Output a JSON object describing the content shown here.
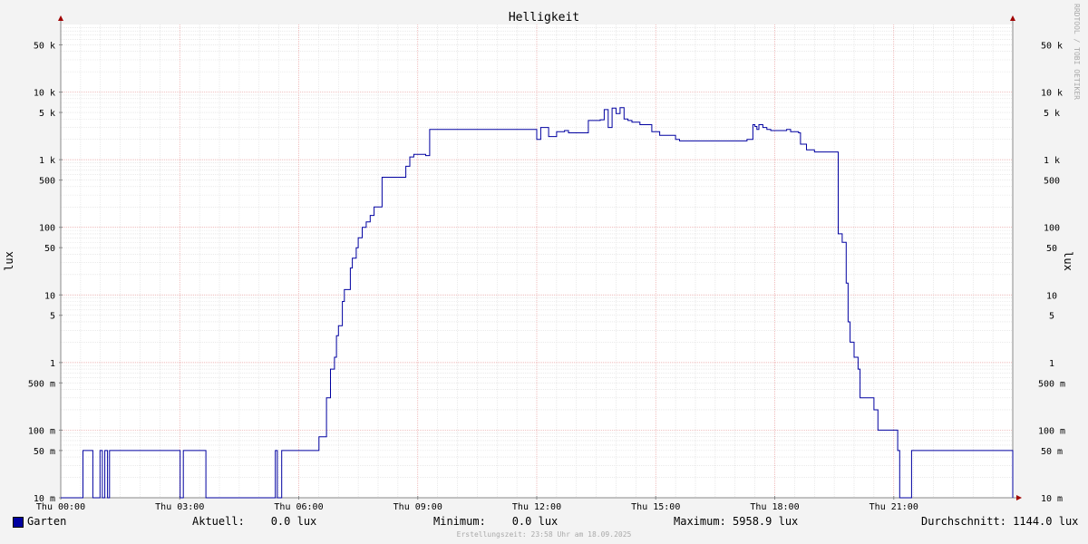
{
  "chart_data": {
    "type": "line",
    "title": "Helligkeit",
    "ylabel": "lux",
    "yscale": "log",
    "ylim": [
      0.01,
      100000
    ],
    "xlim": [
      0,
      24
    ],
    "grid": true,
    "x_ticks": [
      {
        "x": 0,
        "label": "Thu 00:00"
      },
      {
        "x": 3,
        "label": "Thu 03:00"
      },
      {
        "x": 6,
        "label": "Thu 06:00"
      },
      {
        "x": 9,
        "label": "Thu 09:00"
      },
      {
        "x": 12,
        "label": "Thu 12:00"
      },
      {
        "x": 15,
        "label": "Thu 15:00"
      },
      {
        "x": 18,
        "label": "Thu 18:00"
      },
      {
        "x": 21,
        "label": "Thu 21:00"
      }
    ],
    "y_ticks": [
      {
        "v": 50000,
        "label": "50 k"
      },
      {
        "v": 10000,
        "label": "10 k"
      },
      {
        "v": 5000,
        "label": "5 k"
      },
      {
        "v": 1000,
        "label": "1 k"
      },
      {
        "v": 500,
        "label": "500"
      },
      {
        "v": 100,
        "label": "100"
      },
      {
        "v": 50,
        "label": "50"
      },
      {
        "v": 10,
        "label": "10"
      },
      {
        "v": 5,
        "label": "5"
      },
      {
        "v": 1,
        "label": "1"
      },
      {
        "v": 0.5,
        "label": "500 m"
      },
      {
        "v": 0.1,
        "label": "100 m"
      },
      {
        "v": 0.05,
        "label": "50 m"
      },
      {
        "v": 0.01,
        "label": "10 m"
      }
    ],
    "series": [
      {
        "name": "Garten",
        "color": "#0000a0",
        "x_hours": [
          0,
          0.55,
          0.56,
          0.8,
          0.81,
          0.98,
          0.99,
          1.04,
          1.05,
          1.1,
          1.11,
          1.17,
          1.18,
          1.22,
          1.23,
          3.0,
          3.01,
          3.08,
          3.09,
          3.65,
          3.66,
          5.4,
          5.41,
          5.45,
          5.46,
          5.56,
          5.57,
          6.5,
          6.51,
          6.6,
          6.7,
          6.8,
          6.9,
          6.95,
          7.0,
          7.05,
          7.1,
          7.15,
          7.2,
          7.3,
          7.35,
          7.45,
          7.5,
          7.6,
          7.7,
          7.8,
          7.9,
          8.0,
          8.1,
          8.3,
          8.7,
          8.8,
          8.9,
          9.2,
          9.3,
          9.6,
          12.0,
          12.05,
          12.1,
          12.2,
          12.3,
          12.4,
          12.5,
          12.6,
          12.7,
          12.8,
          13.2,
          13.3,
          13.5,
          13.6,
          13.7,
          13.8,
          13.9,
          14.0,
          14.1,
          14.2,
          14.3,
          14.4,
          14.6,
          14.9,
          15.1,
          15.5,
          15.6,
          17.3,
          17.4,
          17.45,
          17.5,
          17.55,
          17.6,
          17.7,
          17.8,
          17.9,
          18.3,
          18.4,
          18.6,
          18.65,
          18.8,
          19.0,
          19.1,
          19.2,
          19.5,
          19.6,
          19.7,
          19.75,
          19.8,
          19.85,
          19.9,
          20.0,
          20.1,
          20.15,
          20.5,
          20.6,
          21.1,
          21.11,
          21.15,
          21.16,
          21.45,
          21.46,
          24.0
        ],
        "y_lux": [
          0.01,
          0.01,
          0.05,
          0.05,
          0.01,
          0.01,
          0.05,
          0.05,
          0.01,
          0.01,
          0.05,
          0.05,
          0.01,
          0.01,
          0.05,
          0.05,
          0.01,
          0.01,
          0.05,
          0.05,
          0.01,
          0.01,
          0.05,
          0.05,
          0.01,
          0.01,
          0.05,
          0.05,
          0.08,
          0.08,
          0.3,
          0.8,
          1.2,
          2.5,
          3.5,
          3.5,
          8,
          12,
          12,
          25,
          35,
          50,
          70,
          100,
          120,
          150,
          200,
          200,
          550,
          550,
          800,
          1100,
          1200,
          1150,
          2800,
          2800,
          2000,
          2000,
          3000,
          3000,
          2200,
          2200,
          2600,
          2600,
          2700,
          2500,
          2500,
          3800,
          3800,
          3900,
          5500,
          3000,
          5800,
          4800,
          5900,
          4000,
          3800,
          3600,
          3300,
          2600,
          2300,
          2000,
          1900,
          2000,
          2000,
          3300,
          3100,
          2800,
          3300,
          3000,
          2800,
          2700,
          2800,
          2600,
          2500,
          1700,
          1400,
          1300,
          1300,
          1300,
          1300,
          80,
          60,
          60,
          15,
          4,
          2,
          1.2,
          0.8,
          0.3,
          0.2,
          0.1,
          0.05,
          0.05,
          0.01,
          0.01,
          0.05,
          0.05,
          0.01,
          0.01,
          0.01
        ]
      }
    ]
  },
  "legend": {
    "label": "Garten",
    "aktuell": "Aktuell:    0.0 lux",
    "minimum": "Minimum:    0.0 lux",
    "maximum": "Maximum: 5958.9 lux",
    "durchschnitt": "Durchschnitt: 1144.0 lux"
  },
  "footer": "Erstellungszeit: 23:58 Uhr am 18.09.2025",
  "watermark": "RRDTOOL / TOBI OETIKER"
}
